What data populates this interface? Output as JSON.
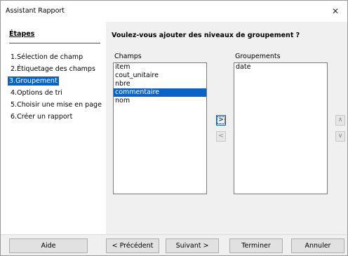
{
  "window": {
    "title": "Assistant Rapport",
    "close_glyph": "✕"
  },
  "steps": {
    "heading": "Étapes",
    "items": [
      {
        "label": "1.Sélection de champ"
      },
      {
        "label": "2.Étiquetage des champs"
      },
      {
        "label": "3.Groupement"
      },
      {
        "label": "4.Options de tri"
      },
      {
        "label": "5.Choisir une mise en page"
      },
      {
        "label": "6.Créer un rapport"
      }
    ],
    "active_index": 2
  },
  "main": {
    "question": "Voulez-vous ajouter des niveaux de groupement ?",
    "fields_label": "Champs",
    "fields": [
      "item",
      "cout_unitaire",
      "nbre",
      "commentaire",
      "nom"
    ],
    "fields_selected": "commentaire",
    "groupings_label": "Groupements",
    "groupings": [
      "date"
    ],
    "add_glyph": ">",
    "remove_glyph": "<",
    "up_glyph": "∧",
    "down_glyph": "∨"
  },
  "footer": {
    "help": "Aide",
    "previous": "< Précédent",
    "next": "Suivant >",
    "finish": "Terminer",
    "cancel": "Annuler"
  },
  "colors": {
    "accent": "#0a64c8"
  }
}
